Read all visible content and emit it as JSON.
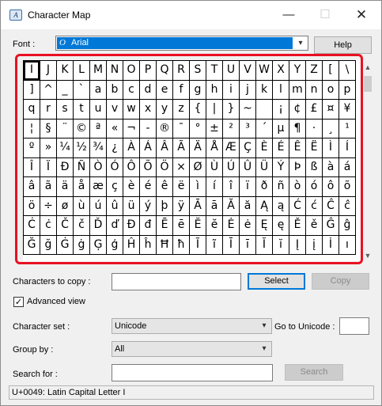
{
  "window": {
    "title": "Character Map",
    "minimize": "—",
    "maximize": "☐",
    "close": "✕"
  },
  "font": {
    "label": "Font :",
    "value": "Arial",
    "help_button": "Help",
    "icon": "opentype-font-icon"
  },
  "grid": {
    "rows": [
      [
        "I",
        "J",
        "K",
        "L",
        "M",
        "N",
        "O",
        "P",
        "Q",
        "R",
        "S",
        "T",
        "U",
        "V",
        "W",
        "X",
        "Y",
        "Z",
        "[",
        "\\"
      ],
      [
        "]",
        "^",
        "_",
        "`",
        "a",
        "b",
        "c",
        "d",
        "e",
        "f",
        "g",
        "h",
        "i",
        "j",
        "k",
        "l",
        "m",
        "n",
        "o",
        "p"
      ],
      [
        "q",
        "r",
        "s",
        "t",
        "u",
        "v",
        "w",
        "x",
        "y",
        "z",
        "{",
        "|",
        "}",
        "~",
        " ",
        "¡",
        "¢",
        "£",
        "¤",
        "¥"
      ],
      [
        "¦",
        "§",
        "¨",
        "©",
        "ª",
        "«",
        "¬",
        "-",
        "®",
        "¯",
        "°",
        "±",
        "²",
        "³",
        "´",
        "µ",
        "¶",
        "·",
        "¸",
        "¹"
      ],
      [
        "º",
        "»",
        "¼",
        "½",
        "¾",
        "¿",
        "À",
        "Á",
        "Â",
        "Ã",
        "Ä",
        "Å",
        "Æ",
        "Ç",
        "È",
        "É",
        "Ê",
        "Ë",
        "Ì",
        "Í"
      ],
      [
        "Î",
        "Ï",
        "Ð",
        "Ñ",
        "Ò",
        "Ó",
        "Ô",
        "Õ",
        "Ö",
        "×",
        "Ø",
        "Ù",
        "Ú",
        "Û",
        "Ü",
        "Ý",
        "Þ",
        "ß",
        "à",
        "á"
      ],
      [
        "â",
        "ã",
        "ä",
        "å",
        "æ",
        "ç",
        "è",
        "é",
        "ê",
        "ë",
        "ì",
        "í",
        "î",
        "ï",
        "ð",
        "ñ",
        "ò",
        "ó",
        "ô",
        "õ"
      ],
      [
        "ö",
        "÷",
        "ø",
        "ù",
        "ú",
        "û",
        "ü",
        "ý",
        "þ",
        "ÿ",
        "Ā",
        "ā",
        "Ă",
        "ă",
        "Ą",
        "ą",
        "Ć",
        "ć",
        "Ĉ",
        "ĉ"
      ],
      [
        "Ċ",
        "ċ",
        "Č",
        "č",
        "Ď",
        "ď",
        "Đ",
        "đ",
        "Ē",
        "ē",
        "Ĕ",
        "ĕ",
        "Ė",
        "ė",
        "Ę",
        "ę",
        "Ě",
        "ě",
        "Ĝ",
        "ĝ"
      ],
      [
        "Ğ",
        "ğ",
        "Ġ",
        "ġ",
        "Ģ",
        "ģ",
        "Ĥ",
        "ĥ",
        "Ħ",
        "ħ",
        "Ĩ",
        "ĩ",
        "Ī",
        "ī",
        "Ĭ",
        "ĭ",
        "Į",
        "į",
        "İ",
        "ı"
      ]
    ],
    "selected": {
      "row": 0,
      "col": 0
    },
    "scroll_up": "▲",
    "scroll_down": "▼"
  },
  "copy": {
    "label": "Characters to copy :",
    "value": "",
    "select_button": "Select",
    "copy_button": "Copy"
  },
  "advanced": {
    "label": "Advanced view",
    "checked": true,
    "check_glyph": "✓"
  },
  "character_set": {
    "label": "Character set :",
    "value": "Unicode",
    "goto_label": "Go to Unicode :",
    "goto_value": ""
  },
  "group_by": {
    "label": "Group by :",
    "value": "All"
  },
  "search": {
    "label": "Search for :",
    "value": "",
    "button": "Search"
  },
  "status": "U+0049: Latin Capital Letter I",
  "colors": {
    "highlight": "#e81123",
    "selection": "#0078d7",
    "default_button": "#0078d7"
  }
}
